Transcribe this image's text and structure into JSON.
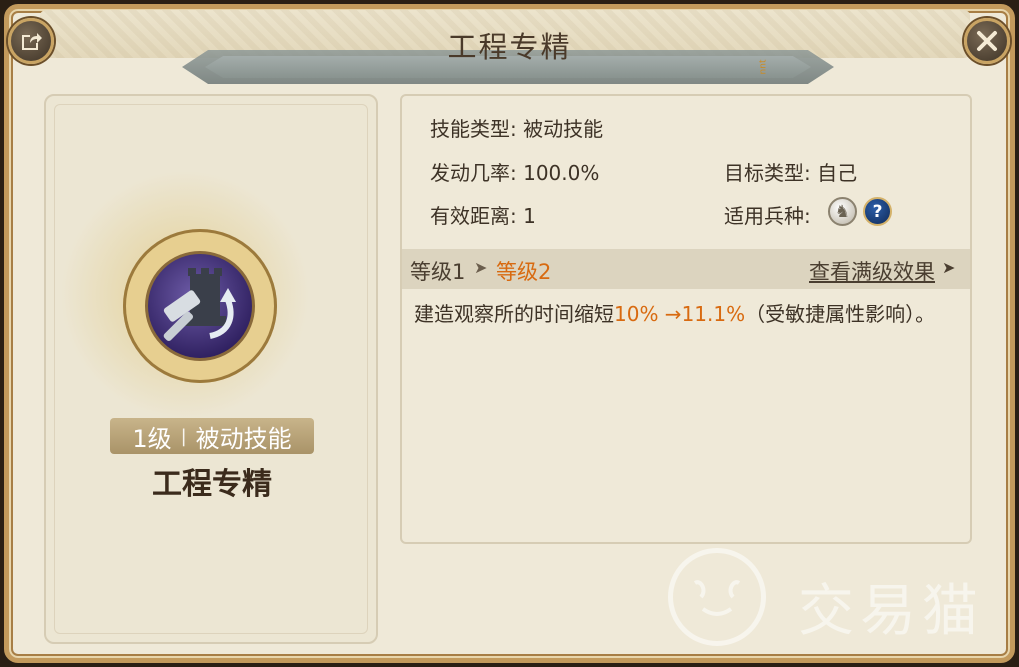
{
  "title": "工程专精",
  "corner_mark": "nnt",
  "icons": {
    "share": "share-icon",
    "close": "close-icon",
    "skill": "hammer-tower-icon",
    "horse": "horse-icon",
    "help": "question-icon"
  },
  "skill": {
    "badge_level": "1级",
    "badge_separator": "|",
    "badge_type": "被动技能",
    "name": "工程专精"
  },
  "info": {
    "skill_type_label": "技能类型:",
    "skill_type_value": "被动技能",
    "trigger_rate_label": "发动几率:",
    "trigger_rate_value": "100.0%",
    "range_label": "有效距离:",
    "range_value": "1",
    "target_type_label": "目标类型:",
    "target_type_value": "自己",
    "troop_label": "适用兵种:",
    "help_glyph": "?"
  },
  "level": {
    "current": "等级1",
    "arrow": "➤",
    "next": "等级2",
    "max_link": "查看满级效果",
    "max_arrow": "➤"
  },
  "description": {
    "prefix": "建造观察所的时间缩短",
    "highlight": "10% →11.1%",
    "suffix": "（受敏捷属性影响）。"
  },
  "watermark": {
    "text": "交易猫"
  },
  "colors": {
    "accent": "#d86a10",
    "frame": "#c39a5c",
    "panel": "#efe9d8",
    "text": "#3d3226"
  }
}
